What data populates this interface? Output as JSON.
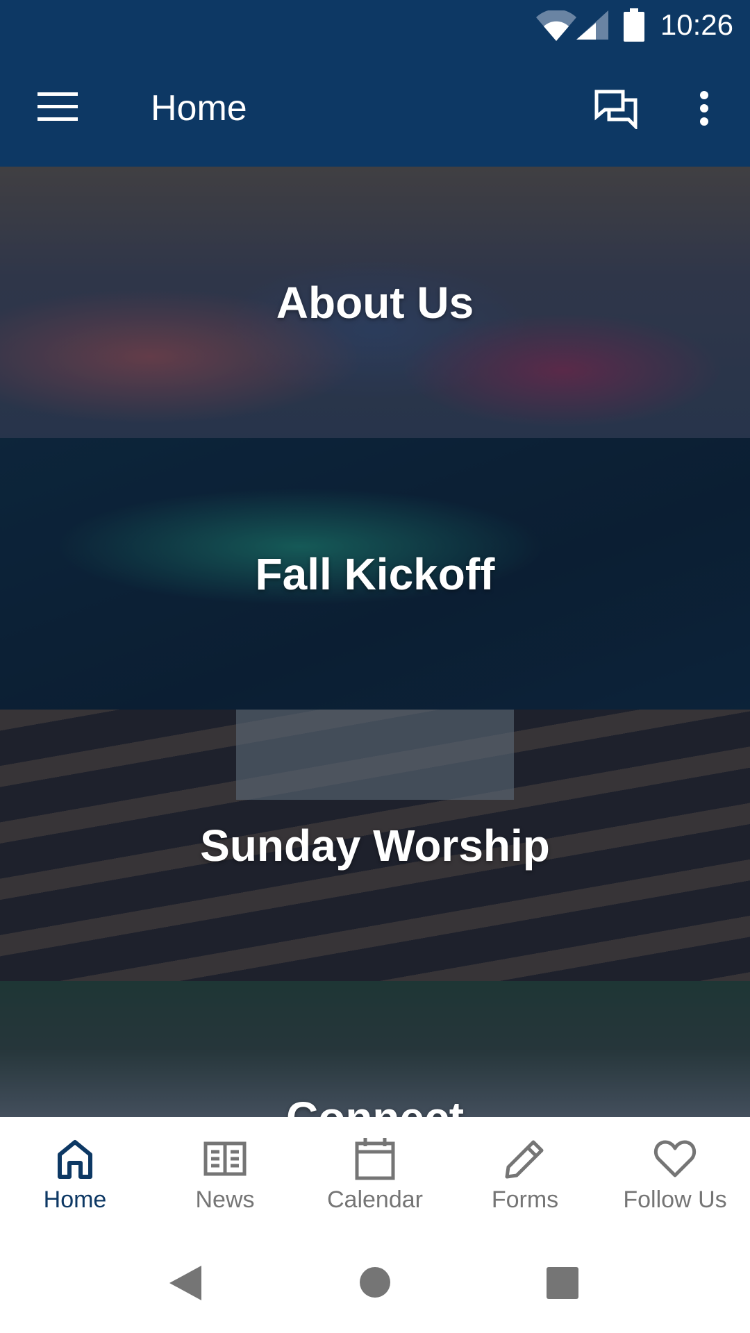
{
  "status_bar": {
    "time": "10:26",
    "icons": [
      "wifi-icon",
      "signal-icon",
      "battery-icon"
    ]
  },
  "app_bar": {
    "title": "Home",
    "icons": [
      "menu-icon",
      "chat-icon",
      "more-vert-icon"
    ]
  },
  "tiles": [
    {
      "label": "About Us"
    },
    {
      "label": "Fall Kickoff"
    },
    {
      "label": "Sunday Worship"
    },
    {
      "label": "Connect"
    }
  ],
  "bottom_nav": [
    {
      "label": "Home",
      "icon": "home-icon",
      "active": true
    },
    {
      "label": "News",
      "icon": "book-icon"
    },
    {
      "label": "Calendar",
      "icon": "calendar-icon"
    },
    {
      "label": "Forms",
      "icon": "pencil-icon"
    },
    {
      "label": "Follow Us",
      "icon": "heart-icon"
    }
  ],
  "colors": {
    "primary": "#0d3864",
    "inactive": "#757575"
  }
}
